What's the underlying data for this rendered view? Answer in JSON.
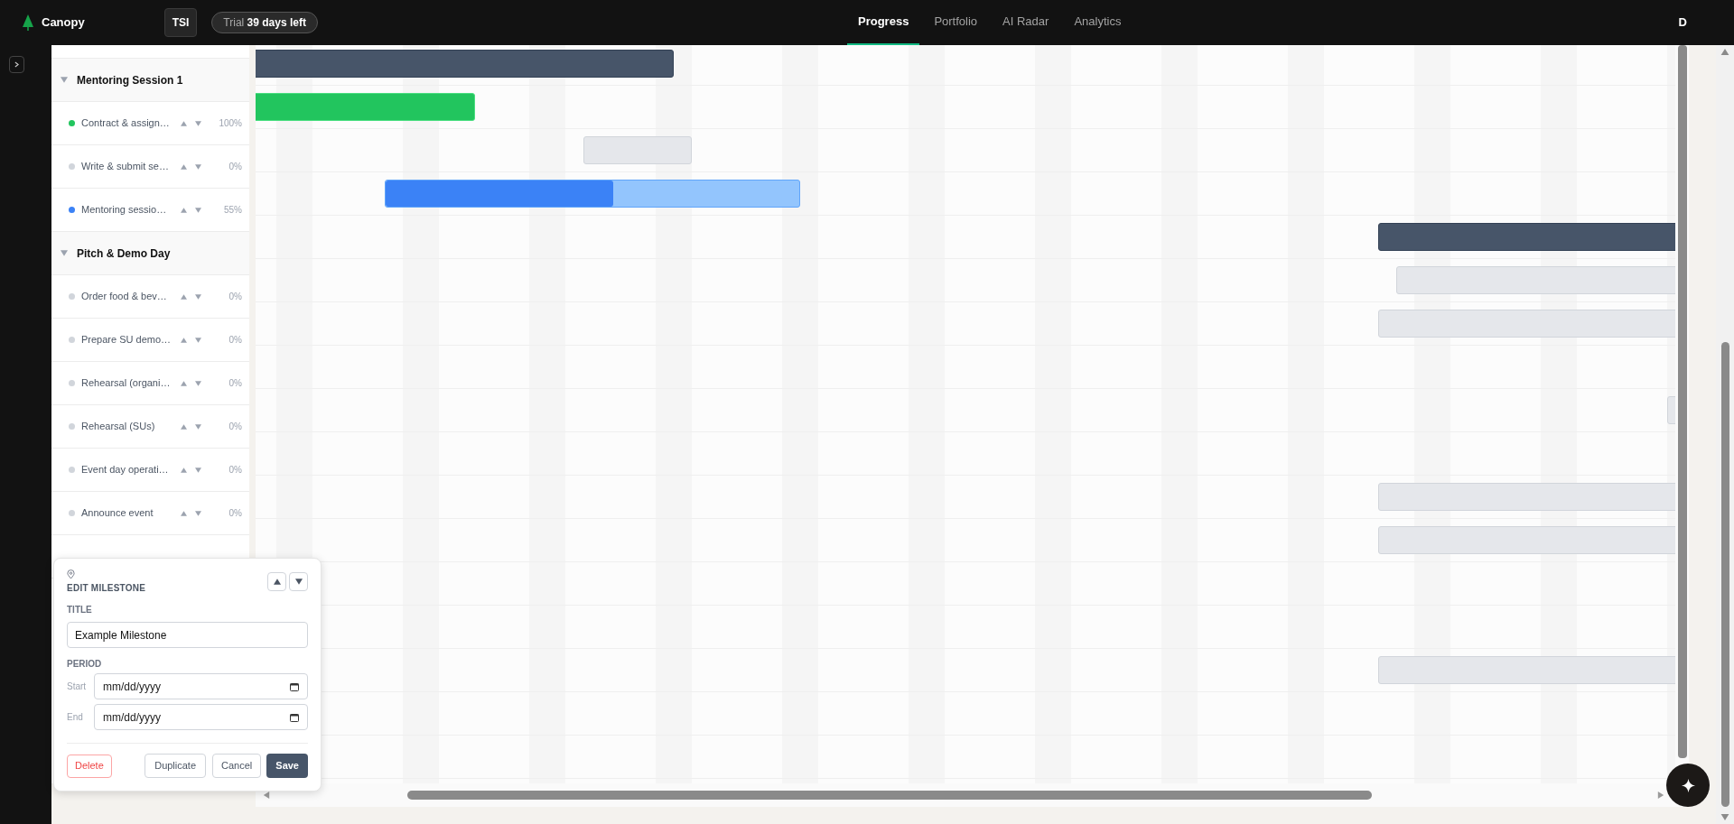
{
  "header": {
    "logo": "Canopy",
    "workspace": "TSI",
    "trial": {
      "label": "Trial",
      "remaining": "39 days left"
    },
    "tabs": [
      {
        "label": "Progress",
        "selected": true
      },
      {
        "label": "Portfolio",
        "selected": false
      },
      {
        "label": "AI Radar",
        "selected": false
      },
      {
        "label": "Analytics",
        "selected": false
      }
    ],
    "user_initial": "D"
  },
  "sidebar": {
    "groups": [
      {
        "title": "Mentoring Session 1",
        "expanded": true,
        "tasks": [
          {
            "name": "Contract & assign…",
            "color": "#22c55e",
            "percent": "100%"
          },
          {
            "name": "Write & submit se…",
            "color": "#d1d5db",
            "percent": "0%"
          },
          {
            "name": "Mentoring sessio…",
            "color": "#3b82f6",
            "percent": "55%"
          }
        ]
      },
      {
        "title": "Pitch & Demo Day",
        "expanded": true,
        "tasks": [
          {
            "name": "Order food & bev…",
            "color": "#d1d5db",
            "percent": "0%"
          },
          {
            "name": "Prepare SU demo…",
            "color": "#d1d5db",
            "percent": "0%"
          },
          {
            "name": "Rehearsal (organi…",
            "color": "#d1d5db",
            "percent": "0%"
          },
          {
            "name": "Rehearsal (SUs)",
            "color": "#d1d5db",
            "percent": "0%"
          },
          {
            "name": "Event day operati…",
            "color": "#d1d5db",
            "percent": "0%"
          },
          {
            "name": "Announce event",
            "color": "#d1d5db",
            "percent": "0%"
          }
        ]
      }
    ]
  },
  "gantt": {
    "rows": [
      {
        "kind": "summary"
      },
      {
        "kind": "complete"
      },
      {
        "kind": "pending"
      },
      {
        "kind": "in_progress",
        "level": 0.55
      },
      {
        "kind": "summary"
      },
      {
        "kind": "pending"
      },
      {
        "kind": "pending"
      },
      {
        "kind": "none"
      },
      {
        "kind": "pending"
      },
      {
        "kind": "none"
      },
      {
        "kind": "pending"
      },
      {
        "kind": "pending"
      },
      {
        "kind": "none"
      },
      {
        "kind": "none"
      },
      {
        "kind": "pending"
      },
      {
        "kind": "none"
      },
      {
        "kind": "none"
      }
    ]
  },
  "editor": {
    "title": "EDIT MILESTONE",
    "title_label": "TITLE",
    "title_value": "Example Milestone",
    "period_label": "PERIOD",
    "start_label": "Start",
    "start_placeholder": "mm/dd/yyyy",
    "end_label": "End",
    "end_placeholder": "mm/dd/yyyy",
    "buttons": {
      "delete": "Delete",
      "duplicate": "Duplicate",
      "cancel": "Cancel",
      "save": "Save"
    }
  }
}
